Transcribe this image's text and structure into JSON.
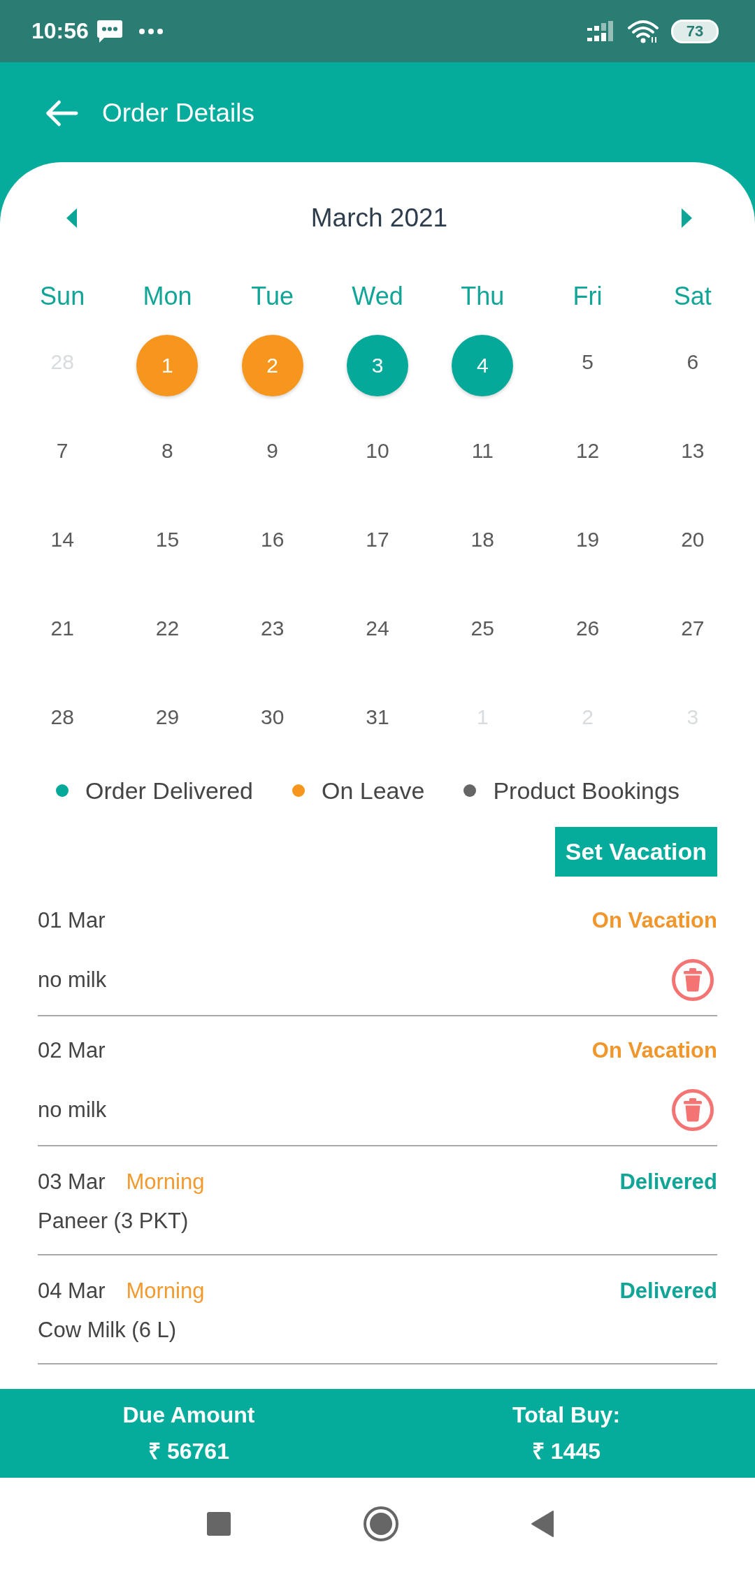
{
  "status_bar": {
    "time": "10:56",
    "battery": "73"
  },
  "app_bar": {
    "title": "Order Details"
  },
  "calendar": {
    "month": "March 2021",
    "weekdays": [
      "Sun",
      "Mon",
      "Tue",
      "Wed",
      "Thu",
      "Fri",
      "Sat"
    ],
    "weeks": [
      [
        {
          "day": "28",
          "outside_month": true
        },
        {
          "day": "1",
          "outside_month": false,
          "color": "#f7961c"
        },
        {
          "day": "2",
          "outside_month": false,
          "color": "#f7961c"
        },
        {
          "day": "3",
          "outside_month": false,
          "color": "#05a99a"
        },
        {
          "day": "4",
          "outside_month": false,
          "color": "#05a99a"
        },
        {
          "day": "5",
          "outside_month": false
        },
        {
          "day": "6",
          "outside_month": false
        }
      ],
      [
        {
          "day": "7",
          "outside_month": false
        },
        {
          "day": "8",
          "outside_month": false
        },
        {
          "day": "9",
          "outside_month": false
        },
        {
          "day": "10",
          "outside_month": false
        },
        {
          "day": "11",
          "outside_month": false
        },
        {
          "day": "12",
          "outside_month": false
        },
        {
          "day": "13",
          "outside_month": false
        }
      ],
      [
        {
          "day": "14",
          "outside_month": false
        },
        {
          "day": "15",
          "outside_month": false
        },
        {
          "day": "16",
          "outside_month": false
        },
        {
          "day": "17",
          "outside_month": false
        },
        {
          "day": "18",
          "outside_month": false
        },
        {
          "day": "19",
          "outside_month": false
        },
        {
          "day": "20",
          "outside_month": false
        }
      ],
      [
        {
          "day": "21",
          "outside_month": false
        },
        {
          "day": "22",
          "outside_month": false
        },
        {
          "day": "23",
          "outside_month": false
        },
        {
          "day": "24",
          "outside_month": false
        },
        {
          "day": "25",
          "outside_month": false
        },
        {
          "day": "26",
          "outside_month": false
        },
        {
          "day": "27",
          "outside_month": false
        }
      ],
      [
        {
          "day": "28",
          "outside_month": false
        },
        {
          "day": "29",
          "outside_month": false
        },
        {
          "day": "30",
          "outside_month": false
        },
        {
          "day": "31",
          "outside_month": false
        },
        {
          "day": "1",
          "outside_month": true
        },
        {
          "day": "2",
          "outside_month": true
        },
        {
          "day": "3",
          "outside_month": true
        }
      ]
    ]
  },
  "legend": [
    {
      "label": "Order Delivered",
      "color": "#05a99a"
    },
    {
      "label": "On Leave",
      "color": "#f7961c"
    },
    {
      "label": "Product Bookings",
      "color": "#666666"
    }
  ],
  "set_vacation_button": {
    "label": "Set Vacation"
  },
  "orders": [
    {
      "kind": "vacation",
      "date": "01 Mar",
      "status": "On Vacation",
      "item": "no milk"
    },
    {
      "kind": "vacation",
      "date": "02 Mar",
      "status": "On Vacation",
      "item": "no milk"
    },
    {
      "kind": "delivery",
      "date": "03 Mar",
      "slot": "Morning",
      "status": "Delivered",
      "item": "Paneer (3 PKT)"
    },
    {
      "kind": "delivery",
      "date": "04 Mar",
      "slot": "Morning",
      "status": "Delivered",
      "item": "Cow Milk (6 L)"
    }
  ],
  "summary": [
    {
      "label": "Due Amount",
      "value": "₹ 56761"
    },
    {
      "label": "Total Buy:",
      "value": "₹ 1445"
    }
  ]
}
